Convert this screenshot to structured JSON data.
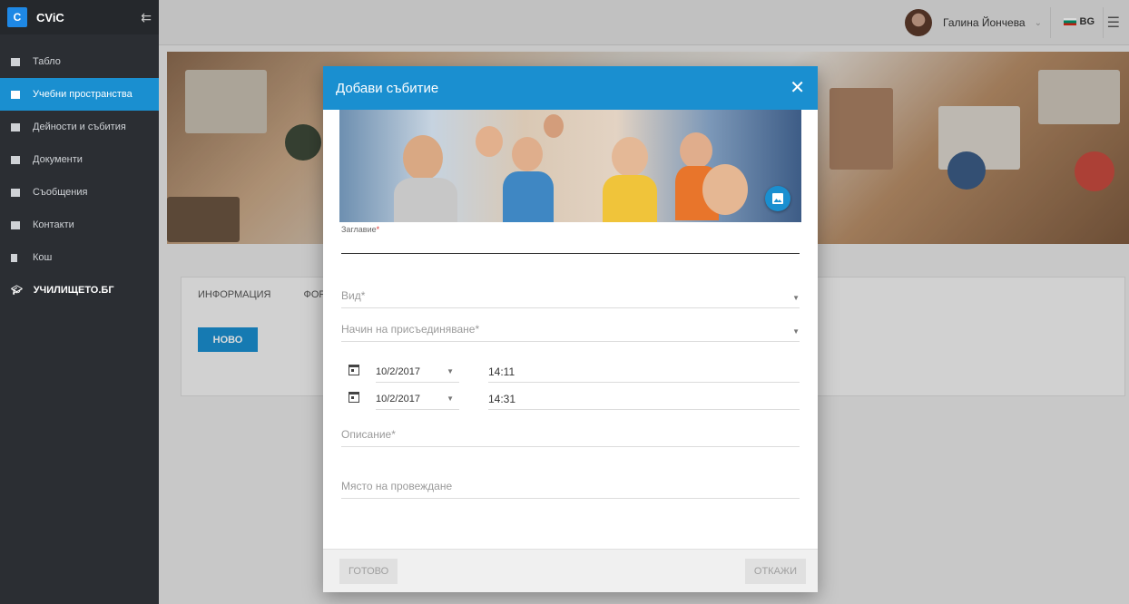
{
  "app": {
    "logo_letter": "C",
    "name": "CViC"
  },
  "sidebar": {
    "items": [
      {
        "label": "Табло"
      },
      {
        "label": "Учебни пространства"
      },
      {
        "label": "Дейности и събития"
      },
      {
        "label": "Документи"
      },
      {
        "label": "Съобщения"
      },
      {
        "label": "Контакти"
      },
      {
        "label": "Кош"
      },
      {
        "label": "УЧИЛИЩЕТО.БГ"
      }
    ],
    "active_index": 1
  },
  "topbar": {
    "user_name": "Галина Йончева",
    "language": "BG"
  },
  "content": {
    "tabs": [
      "ИНФОРМАЦИЯ",
      "ФОРУ"
    ],
    "new_button": "НОВО"
  },
  "modal": {
    "title": "Добави събитие",
    "close": "✕",
    "title_label": "Заглавие",
    "type_label": "Вид",
    "join_label": "Начин на присъединяване",
    "start": {
      "date": "10/2/2017",
      "time": "14:11"
    },
    "end": {
      "date": "10/2/2017",
      "time": "14:31"
    },
    "description_label": "Описание",
    "location_label": "Място на провеждане",
    "done_button": "ГОТОВО",
    "cancel_button": "ОТКАЖИ",
    "required_mark": "*"
  },
  "colors": {
    "accent": "#1a8fd0",
    "sidebar_bg": "#2b2e33"
  }
}
